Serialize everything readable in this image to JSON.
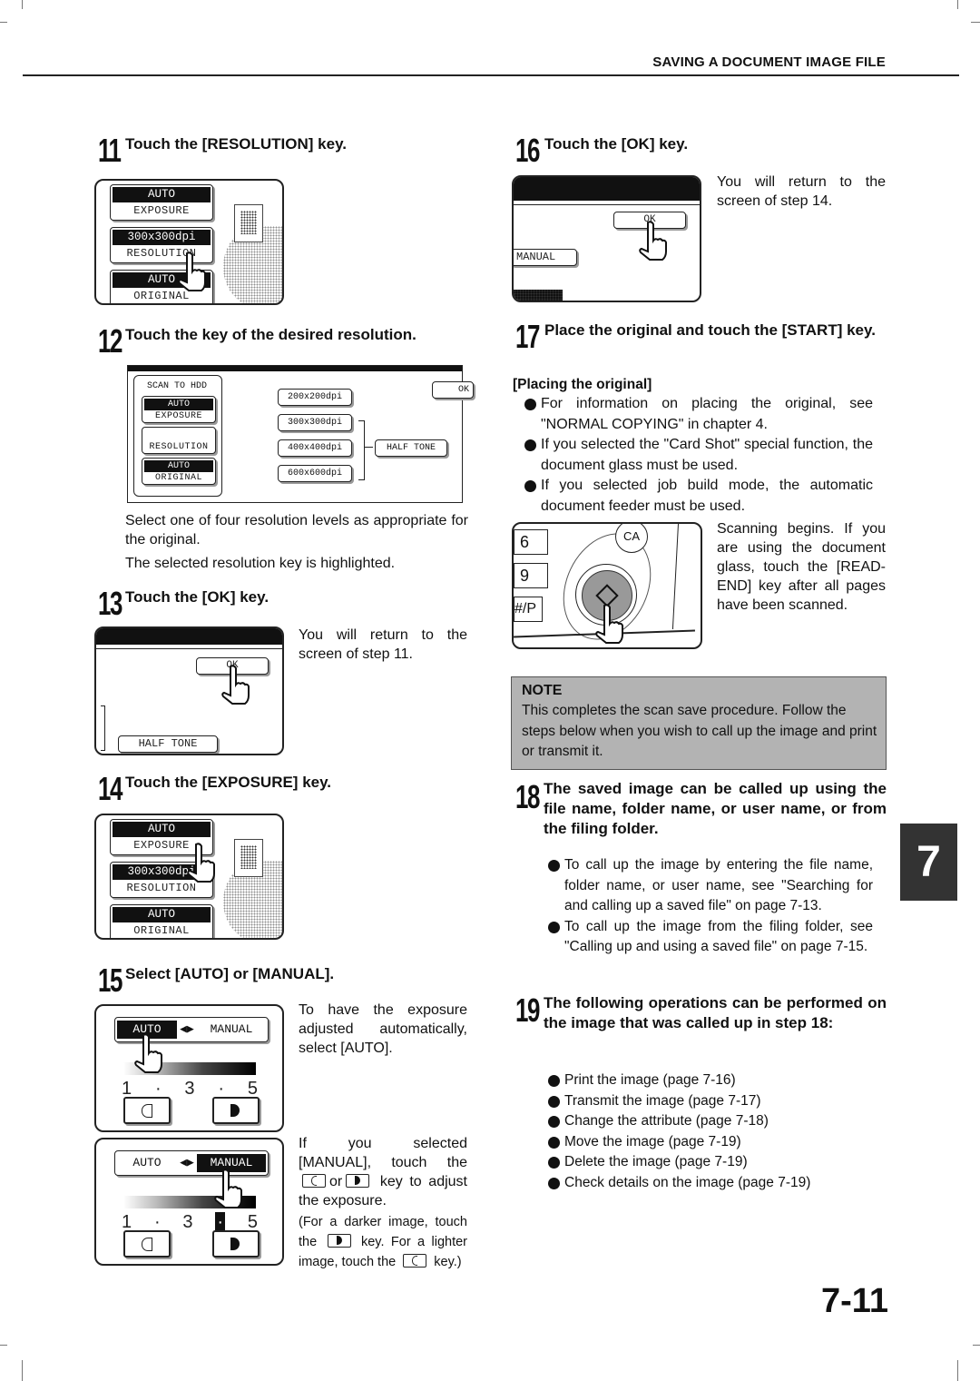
{
  "header": {
    "section_title": "SAVING A DOCUMENT IMAGE FILE"
  },
  "steps": {
    "s11": {
      "num": "11",
      "title": "Touch the [RESOLUTION] key.",
      "screen": {
        "exposure_value": "AUTO",
        "exposure_label": "EXPOSURE",
        "resolution_value": "300x300dpi",
        "resolution_label": "RESOLUTION",
        "original_value": "AUTO",
        "original_label": "ORIGINAL"
      }
    },
    "s12": {
      "num": "12",
      "title": "Touch the key of the desired resolution.",
      "screen": {
        "mode_label": "SCAN TO HDD",
        "exposure_value": "AUTO",
        "exposure_label": "EXPOSURE",
        "resolution_label": "RESOLUTION",
        "original_value": "AUTO",
        "original_label": "ORIGINAL",
        "resolutions": [
          "200x200dpi",
          "300x300dpi",
          "400x400dpi",
          "600x600dpi"
        ],
        "halftone_label": "HALF TONE",
        "ok_label": "OK"
      },
      "desc1": "Select one of four resolution levels as appropriate for the original.",
      "desc2": "The selected resolution key is highlighted."
    },
    "s13": {
      "num": "13",
      "title": "Touch the [OK] key.",
      "screen": {
        "ok_label": "OK",
        "halftone_label": "HALF TONE"
      },
      "desc": "You will return to the screen of step 11."
    },
    "s14": {
      "num": "14",
      "title": "Touch the [EXPOSURE] key.",
      "screen": {
        "exposure_value": "AUTO",
        "exposure_label": "EXPOSURE",
        "resolution_value": "300x300dpi",
        "resolution_label": "RESOLUTION",
        "original_value": "AUTO",
        "original_label": "ORIGINAL"
      }
    },
    "s15": {
      "num": "15",
      "title": "Select [AUTO] or [MANUAL].",
      "panel_auto": {
        "auto_label": "AUTO",
        "manual_label": "MANUAL",
        "selected": "AUTO",
        "scale": [
          "1",
          "·",
          "3",
          "·",
          "5"
        ]
      },
      "panel_manual": {
        "auto_label": "AUTO",
        "manual_label": "MANUAL",
        "selected": "MANUAL",
        "scale": [
          "1",
          "·",
          "3",
          "·",
          "5"
        ],
        "level": 4
      },
      "desc_auto": "To have the exposure adjusted automatically, select [AUTO].",
      "desc_manual_1": "If you selected [MANUAL], touch the",
      "desc_manual_or": "or",
      "desc_manual_2": "key to adjust the exposure.",
      "note_1": "(For a darker image, touch the",
      "note_2": "key. For a lighter image, touch the",
      "note_3": "key.)"
    },
    "s16": {
      "num": "16",
      "title": "Touch the [OK] key.",
      "screen": {
        "ok_label": "OK",
        "manual_label": "MANUAL"
      },
      "desc": "You will return to the screen of step 14."
    },
    "s17": {
      "num": "17",
      "title": "Place the original and touch the [START] key.",
      "subheading": "[Placing the original]",
      "bullets": [
        "For information on placing the original, see \"NORMAL COPYING\" in chapter 4.",
        "If you selected the \"Card Shot\" special function, the document glass must be used.",
        "If you selected job build mode, the automatic document feeder must be used."
      ],
      "panel": {
        "key_6": "6",
        "key_9": "9",
        "key_hash": "#/P",
        "ca_label": "CA"
      },
      "desc": "Scanning begins. If you are using the document glass, touch the [READ-END] key after all pages have been scanned."
    },
    "s18": {
      "num": "18",
      "title": "The saved image can be called up using the file name, folder name, or user name, or from the filing folder.",
      "bullets": [
        "To call up the image by entering the file name, folder name, or user name, see \"Searching for and calling up a saved file\" on page 7-13.",
        "To call up the image from the filing folder, see \"Calling up and using a saved file\" on page 7-15."
      ]
    },
    "s19": {
      "num": "19",
      "title": "The following operations can be performed on the image that was called up in step 18:",
      "bullets": [
        "Print the image (page 7-16)",
        "Transmit the image (page 7-17)",
        "Change the attribute (page 7-18)",
        "Move the image (page 7-19)",
        "Delete the image (page 7-19)",
        "Check details on the image (page 7-19)"
      ]
    }
  },
  "note": {
    "title": "NOTE",
    "body": "This completes the scan save procedure. Follow the steps below when you wish to call up the image and print or transmit it."
  },
  "chapter_tab": "7",
  "page_number": "7-11"
}
